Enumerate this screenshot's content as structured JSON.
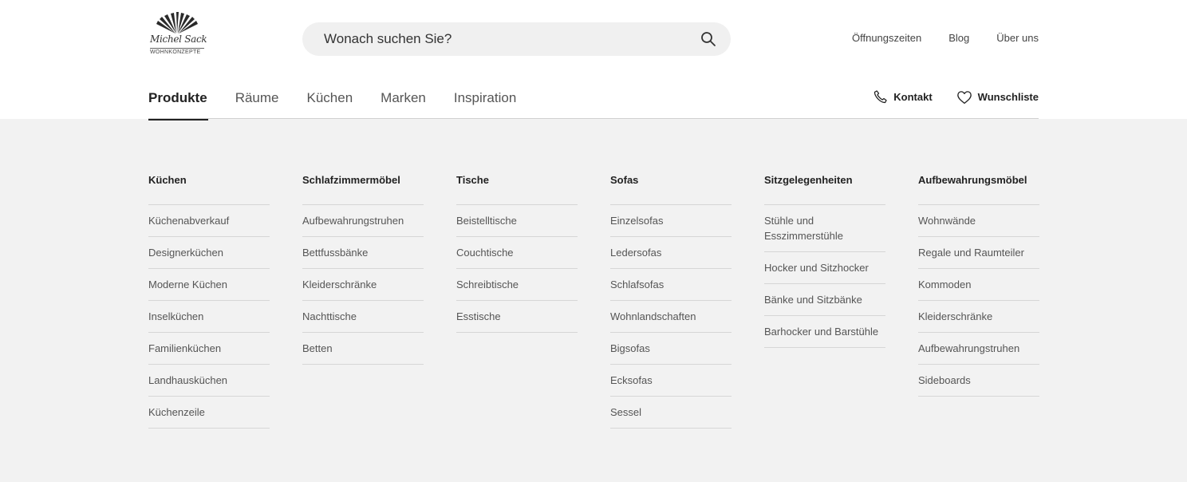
{
  "logo": {
    "script": "Michel Sack",
    "subtitle": "WOHNKONZEPTE"
  },
  "search": {
    "placeholder": "Wonach suchen Sie?"
  },
  "top_links": [
    "Öffnungszeiten",
    "Blog",
    "Über uns"
  ],
  "main_nav": [
    "Produkte",
    "Räume",
    "Küchen",
    "Marken",
    "Inspiration"
  ],
  "active_tab": "Produkte",
  "util": {
    "contact": "Kontakt",
    "wishlist": "Wunschliste"
  },
  "icons": {
    "search": "search-icon",
    "contact": "phone-icon",
    "wishlist": "heart-icon",
    "logo": "fan-logo-icon"
  },
  "mega_menu": [
    {
      "title": "Küchen",
      "items": [
        "Küchenabverkauf",
        "Designerküchen",
        "Moderne Küchen",
        "Inselküchen",
        "Familienküchen",
        "Landhausküchen",
        "Küchenzeile"
      ]
    },
    {
      "title": "Schlafzimmermöbel",
      "items": [
        "Aufbewahrungstruhen",
        "Bettfussbänke",
        "Kleiderschränke",
        "Nachttische",
        "Betten"
      ]
    },
    {
      "title": "Tische",
      "items": [
        "Beistelltische",
        "Couchtische",
        "Schreibtische",
        "Esstische"
      ]
    },
    {
      "title": "Sofas",
      "items": [
        "Einzelsofas",
        "Ledersofas",
        "Schlafsofas",
        "Wohnlandschaften",
        "Bigsofas",
        "Ecksofas",
        "Sessel"
      ]
    },
    {
      "title": "Sitzgelegenheiten",
      "items": [
        "Stühle und Esszimmerstühle",
        "Hocker und Sitzhocker",
        "Bänke und Sitzbänke",
        "Barhocker und Barstühle"
      ]
    },
    {
      "title": "Aufbewahrungsmöbel",
      "items": [
        "Wohnwände",
        "Regale und Raumteiler",
        "Kommoden",
        "Kleiderschränke",
        "Aufbewahrungstruhen",
        "Sideboards"
      ]
    }
  ],
  "colors": {
    "header_bg": "#ffffff",
    "menu_bg": "#f2f2f2",
    "text": "#222222",
    "divider": "#d6d6d6"
  }
}
